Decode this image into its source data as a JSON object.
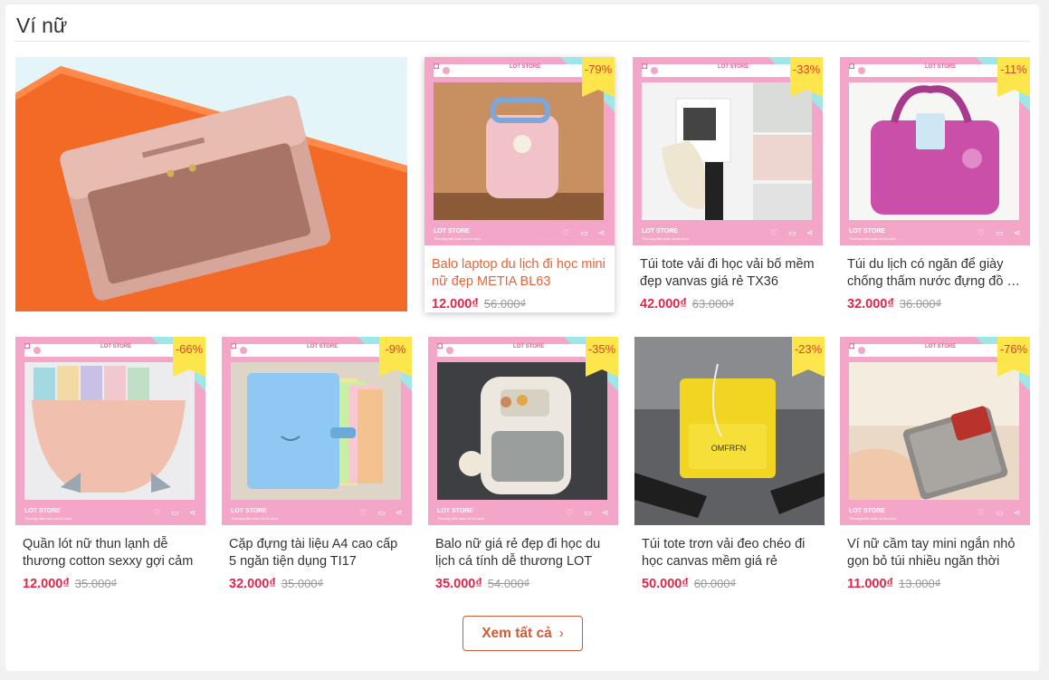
{
  "section": {
    "title": "Ví nữ"
  },
  "store_frame": {
    "store": "LOT STORE",
    "subline": "Thương hiệu balo và túi xách"
  },
  "products": [
    {
      "name": "Balo laptop du lịch đi học mini nữ đẹp METIA BL63",
      "price": "12.000₫",
      "old_price": "56.000₫",
      "discount": "-79%"
    },
    {
      "name": "Túi tote vải đi học vải bố mềm đẹp vanvas giá rẻ TX36",
      "price": "42.000₫",
      "old_price": "63.000₫",
      "discount": "-33%"
    },
    {
      "name": "Túi du lịch có ngăn để giày chống thấm nước đựng đồ du lịch",
      "price": "32.000₫",
      "old_price": "36.000₫",
      "discount": "-11%"
    },
    {
      "name": "Quần lót nữ thun lạnh dễ thương cotton sexxy gợi cảm",
      "price": "12.000₫",
      "old_price": "35.000₫",
      "discount": "-66%"
    },
    {
      "name": "Cặp đựng tài liệu A4 cao cấp 5 ngăn tiện dụng TI17",
      "price": "32.000₫",
      "old_price": "35.000₫",
      "discount": "-9%"
    },
    {
      "name": "Balo nữ giá rẻ đẹp đi học du lịch cá tính dễ thương LOT",
      "price": "35.000₫",
      "old_price": "54.000₫",
      "discount": "-35%"
    },
    {
      "name": "Túi tote trơn vải đeo chéo đi học canvas mềm giá rẻ",
      "price": "50.000₫",
      "old_price": "60.000₫",
      "discount": "-23%"
    },
    {
      "name": "Ví nữ cầm tay mini ngắn nhỏ gọn bỏ túi nhiều ngăn thời",
      "price": "11.000₫",
      "old_price": "13.000₫",
      "discount": "-76%"
    }
  ],
  "actions": {
    "see_all": "Xem tất cả"
  },
  "colors": {
    "accent": "#d25a36",
    "price": "#e2254a",
    "badge": "#fde64b",
    "frame_pink": "#f4a6c8"
  },
  "icons": [
    "camera-icon",
    "heart-icon",
    "chat-icon",
    "share-icon",
    "chevron-right-icon"
  ]
}
